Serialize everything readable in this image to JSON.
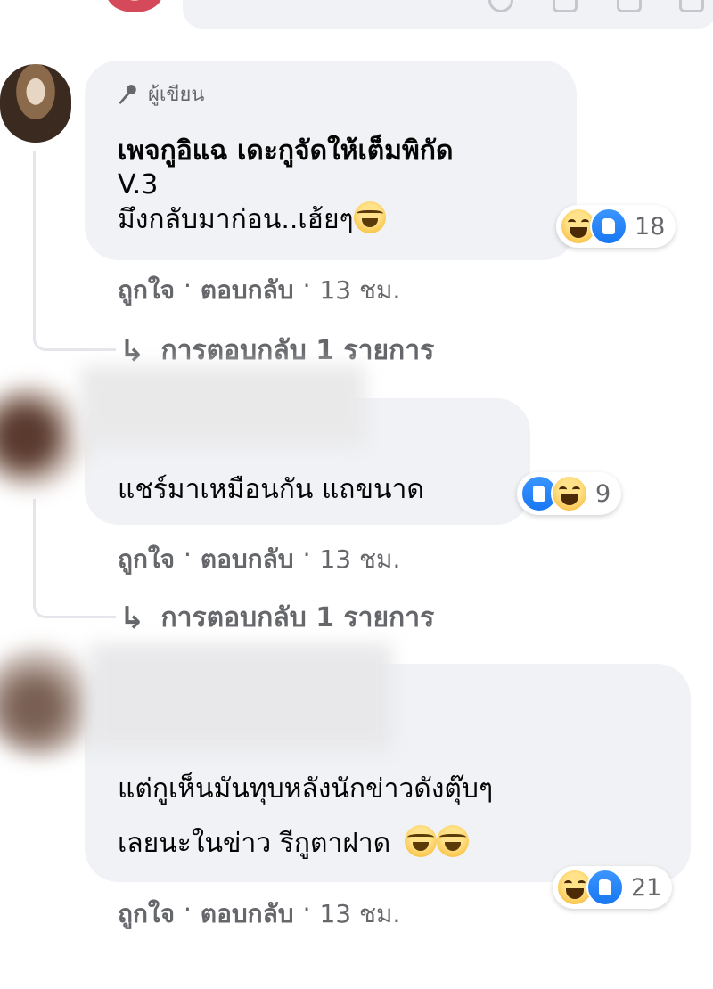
{
  "comments": [
    {
      "author_badge": "ผู้เขียน",
      "lines": [
        "เพจกูอิแฉ เดะกูจัดให้เต็มพิกัด",
        "V.3",
        "มึงกลับมาก่อน..เฮ้ยๆ"
      ],
      "reaction_count": "18",
      "actions": {
        "like": "ถูกใจ",
        "reply": "ตอบกลับ",
        "time": "13 ชม."
      },
      "replies_label": "การตอบกลับ 1 รายการ"
    },
    {
      "lines": [
        "แชร์มาเหมือนกัน แถขนาด"
      ],
      "reaction_count": "9",
      "actions": {
        "like": "ถูกใจ",
        "reply": "ตอบกลับ",
        "time": "13 ชม."
      },
      "replies_label": "การตอบกลับ 1 รายการ"
    },
    {
      "lines": [
        "แต่กูเห็นมันทุบหลังนักข่าวดังตุ๊บๆ",
        "เลยนะในข่าว รีกูตาฝาด"
      ],
      "reaction_count": "21",
      "actions": {
        "like": "ถูกใจ",
        "reply": "ตอบกลับ",
        "time": "13 ชม."
      }
    }
  ],
  "colors": {
    "bubble": "#f0f2f5",
    "meta": "#65676b",
    "like_blue": "#1877f2",
    "haha_yellow": "#f7b125"
  }
}
